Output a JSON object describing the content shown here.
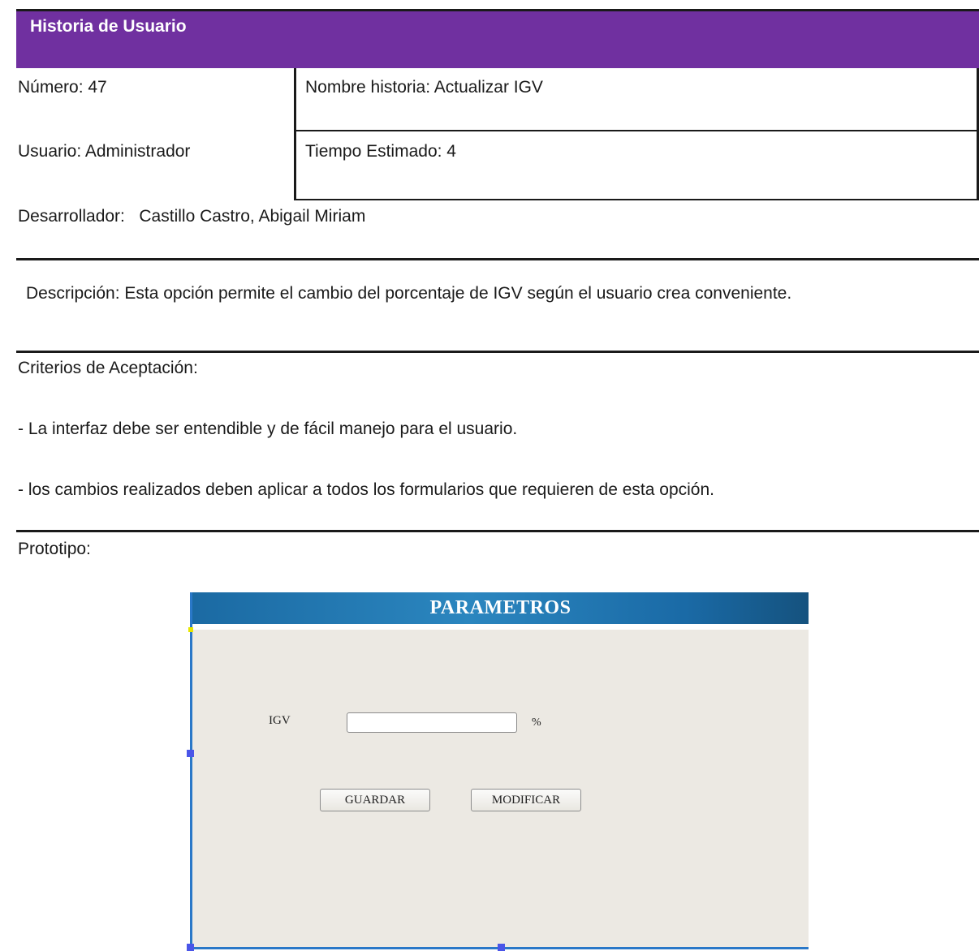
{
  "header": {
    "title": "Historia de Usuario",
    "color": "#7030a0"
  },
  "story": {
    "numero": "Número: 47",
    "nombre": "Nombre historia: Actualizar IGV",
    "usuario": "Usuario: Administrador",
    "tiempo": "Tiempo Estimado: 4",
    "desarrollador": "Desarrollador:   Castillo Castro, Abigail Miriam"
  },
  "descripcion": "Descripción: Esta opción permite el cambio del porcentaje de IGV según el usuario crea conveniente.",
  "criterios": {
    "title": "Criterios de Aceptación:",
    "items": [
      "- La interfaz debe ser entendible y de fácil manejo para el usuario.",
      "- los cambios realizados deben aplicar a todos los formularios que requieren de esta opción."
    ]
  },
  "prototipo": {
    "label": "Prototipo:",
    "window_title": "PARAMETROS",
    "igv_label": "IGV",
    "igv_value": "",
    "percent": "%",
    "guardar": "GUARDAR",
    "modificar": "MODIFICAR"
  }
}
